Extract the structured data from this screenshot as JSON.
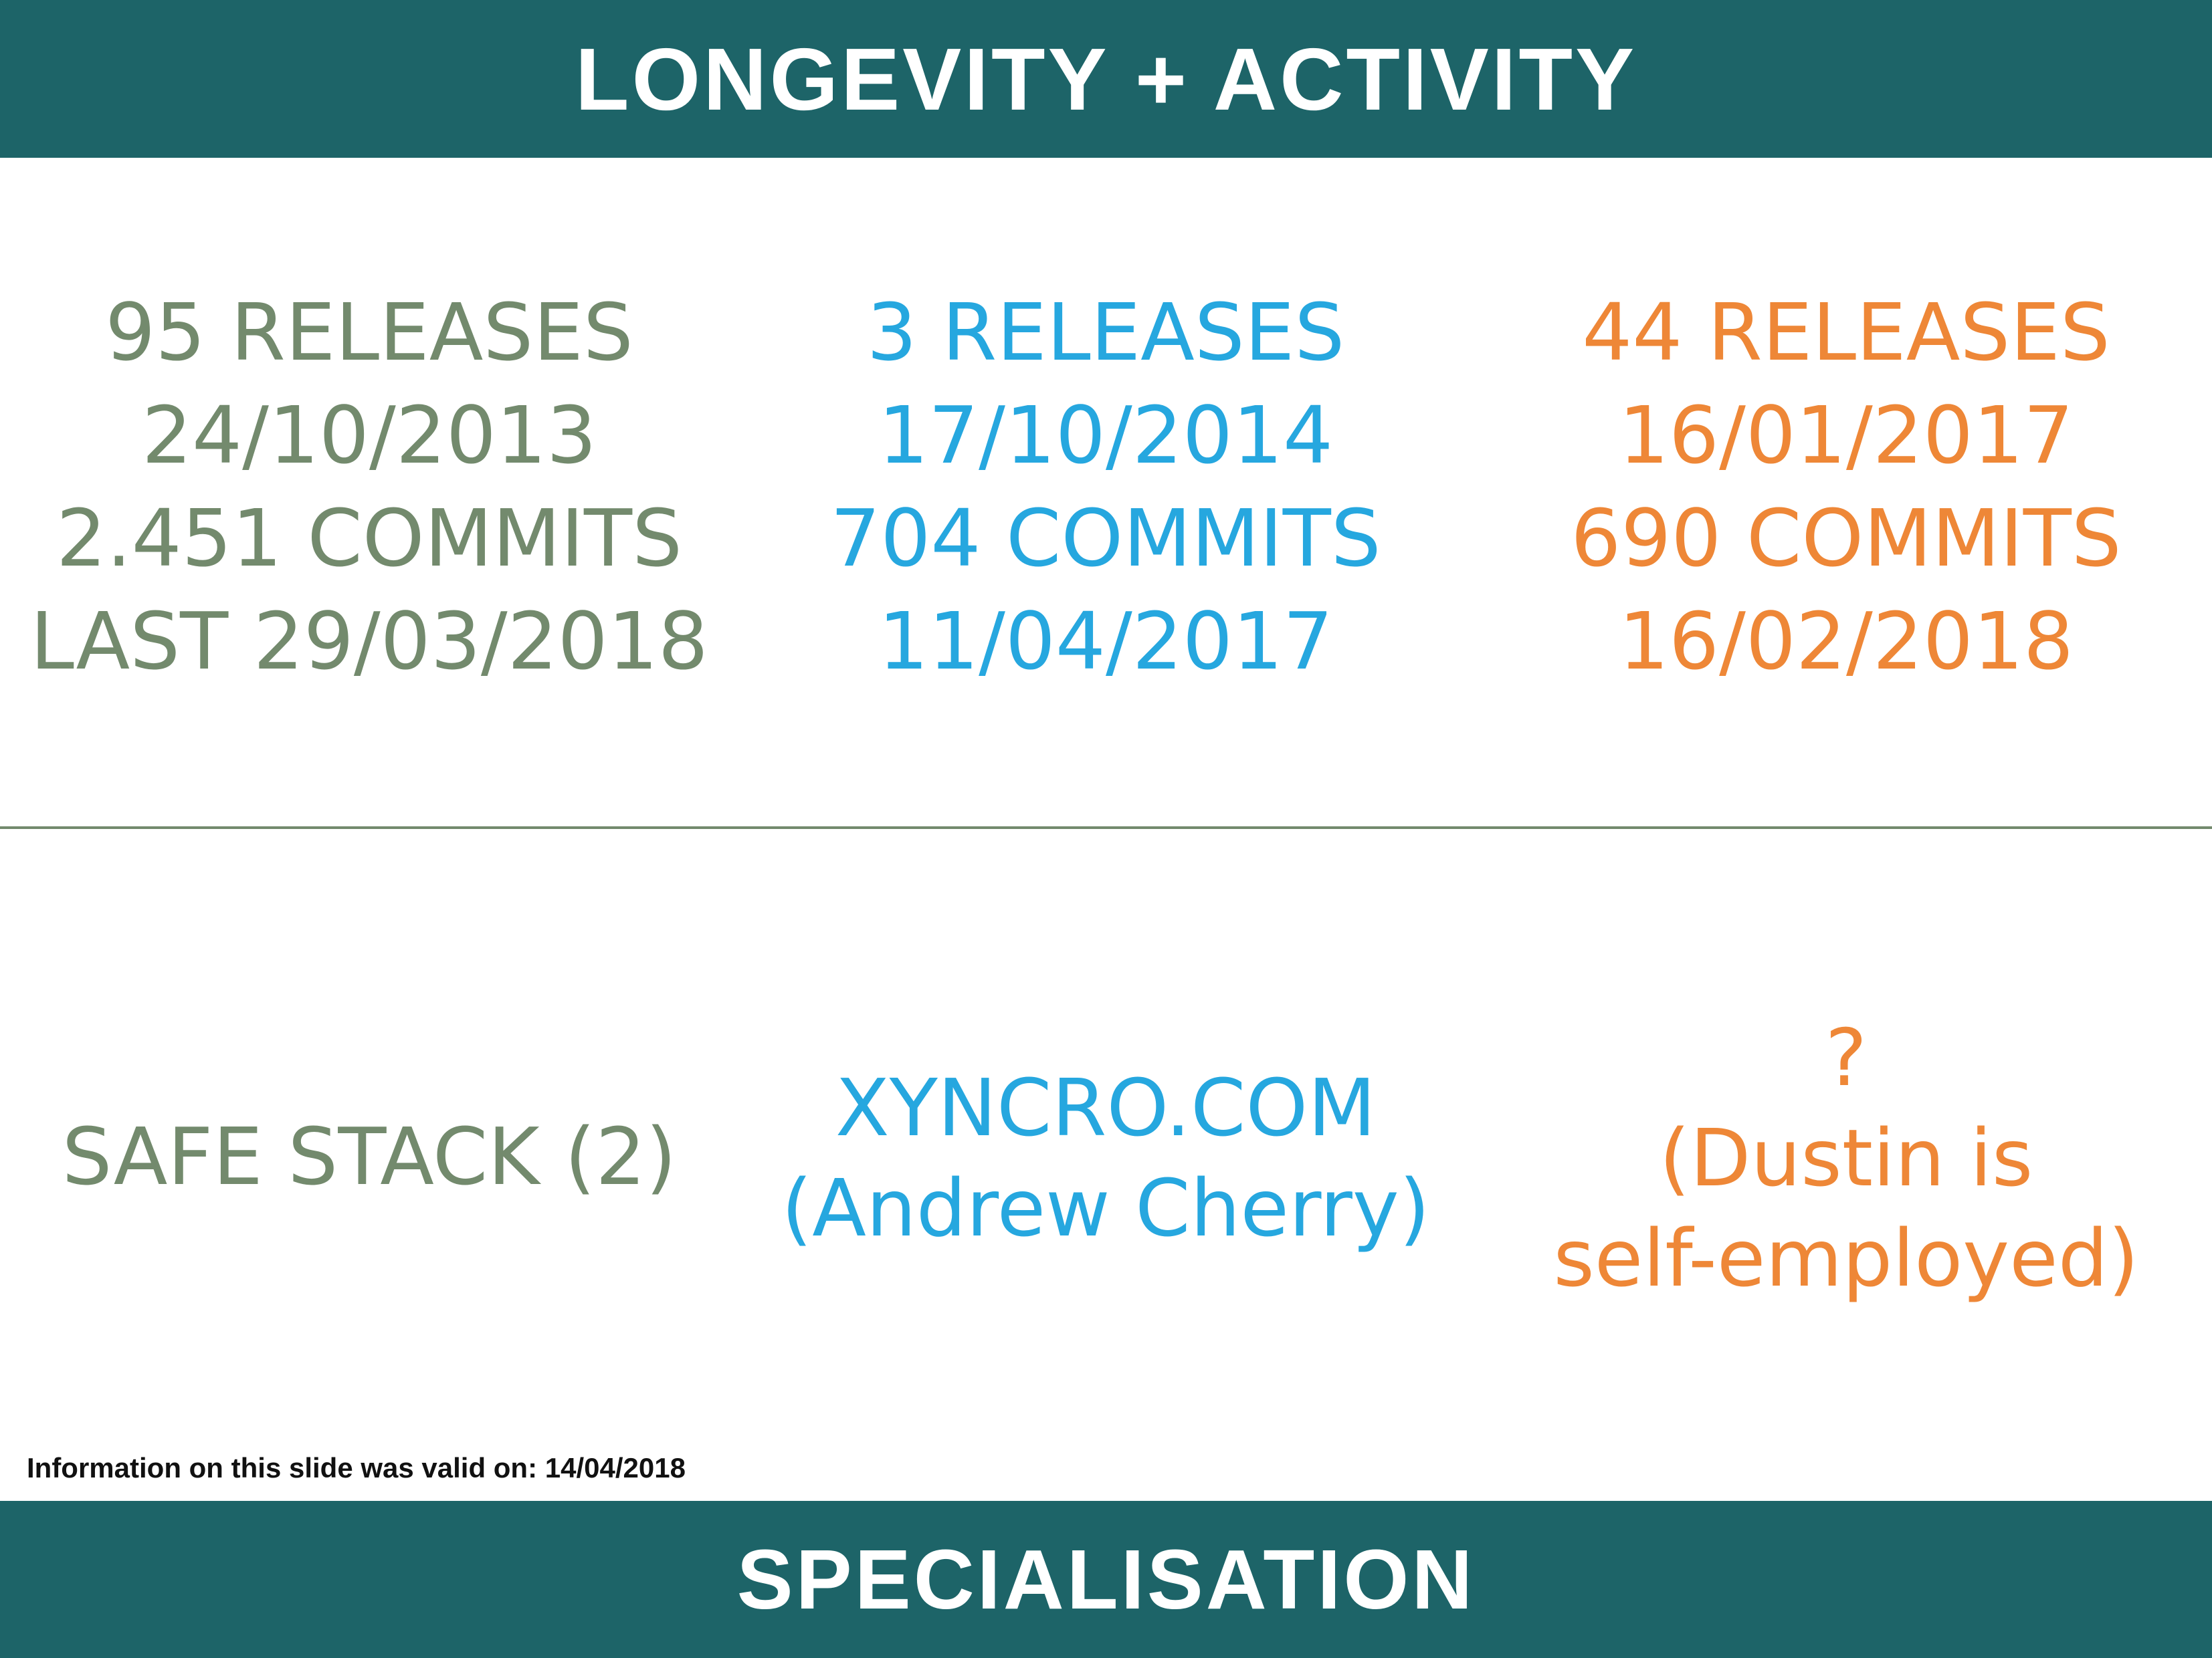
{
  "header": {
    "title": "LONGEVITY + ACTIVITY"
  },
  "stats": {
    "col1": {
      "releases": "95 RELEASES",
      "first_date": "24/10/2013",
      "commits": "2.451 COMMITS",
      "last": "LAST 29/03/2018"
    },
    "col2": {
      "releases": "3 RELEASES",
      "first_date": "17/10/2014",
      "commits": "704 COMMITS",
      "last": "11/04/2017"
    },
    "col3": {
      "releases": "44 RELEASES",
      "first_date": "16/01/2017",
      "commits": "690 COMMITS",
      "last": "16/02/2018"
    }
  },
  "specialisation": {
    "col1": {
      "line1": "SAFE STACK (2)"
    },
    "col2": {
      "line1": "XYNCRO.COM",
      "line2": "(Andrew Cherry)"
    },
    "col3": {
      "line1": "?",
      "line2": "(Dustin is",
      "line3": "self-employed)"
    }
  },
  "footnote": "Information on this slide was valid on: 14/04/2018",
  "footer": {
    "title": "SPECIALISATION"
  },
  "colors": {
    "banner": "#1d6468",
    "green": "#738a6d",
    "blue": "#26a7df",
    "orange": "#ee8737"
  }
}
